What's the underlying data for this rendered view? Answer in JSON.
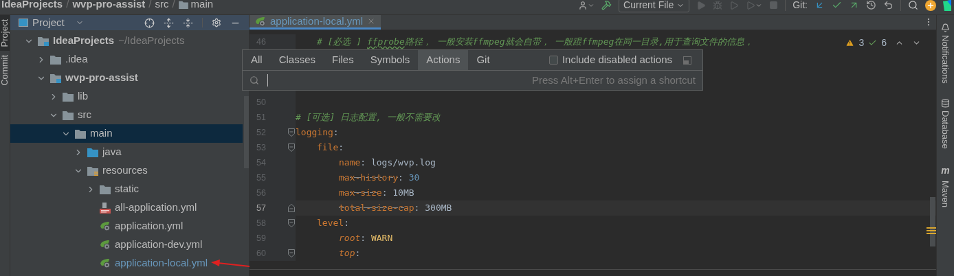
{
  "breadcrumb": [
    {
      "kind": "bold",
      "label": "IdeaProjects"
    },
    {
      "kind": "separator",
      "label": "/"
    },
    {
      "kind": "bold",
      "label": "wvp-pro-assist"
    },
    {
      "kind": "separator",
      "label": "/"
    },
    {
      "kind": "plain",
      "label": "src"
    },
    {
      "kind": "separator",
      "label": "/"
    },
    {
      "kind": "folder",
      "label": "main"
    }
  ],
  "toolbar": {
    "run_config": "Current File",
    "vcs_label": "Git:"
  },
  "side_tabs_left": [
    {
      "label": "Project",
      "selected": true
    },
    {
      "label": "Commit",
      "selected": false
    }
  ],
  "project_panel": {
    "title": "Project",
    "tree": [
      {
        "label": "IdeaProjects",
        "hint": "~/IdeaProjects",
        "kind": "module",
        "expanded": true,
        "selected": false,
        "modified": false,
        "children": [
          {
            "label": ".idea",
            "kind": "folder",
            "expanded": false,
            "selected": false,
            "modified": false
          },
          {
            "label": "wvp-pro-assist",
            "kind": "module",
            "expanded": true,
            "selected": false,
            "modified": false,
            "children": [
              {
                "label": "lib",
                "kind": "folder",
                "expanded": false,
                "selected": false,
                "modified": false
              },
              {
                "label": "src",
                "kind": "folder",
                "expanded": true,
                "selected": false,
                "modified": false,
                "children": [
                  {
                    "label": "main",
                    "kind": "folder",
                    "expanded": true,
                    "selected": true,
                    "modified": false,
                    "children": [
                      {
                        "label": "java",
                        "kind": "source-folder",
                        "expanded": false,
                        "selected": false,
                        "modified": false
                      },
                      {
                        "label": "resources",
                        "kind": "resources-folder",
                        "expanded": true,
                        "selected": false,
                        "modified": false,
                        "children": [
                          {
                            "label": "static",
                            "kind": "folder",
                            "expanded": false,
                            "selected": false,
                            "modified": false
                          },
                          {
                            "label": "all-application.yml",
                            "kind": "yaml-file",
                            "selected": false,
                            "modified": false
                          },
                          {
                            "label": "application.yml",
                            "kind": "spring-file",
                            "selected": false,
                            "modified": false
                          },
                          {
                            "label": "application-dev.yml",
                            "kind": "spring-file",
                            "selected": false,
                            "modified": false
                          },
                          {
                            "label": "application-local.yml",
                            "kind": "spring-file",
                            "selected": false,
                            "modified": true
                          }
                        ]
                      }
                    ]
                  }
                ]
              }
            ]
          }
        ]
      }
    ]
  },
  "editor": {
    "tabs": [
      {
        "label": "application-local.yml",
        "selected": true
      }
    ],
    "inspections": {
      "warnings": "3",
      "weak_warnings": "6"
    },
    "lines": [
      {
        "number": "46",
        "kind": "indent-1",
        "fold_start": false,
        "fold_end": false,
        "current": false,
        "tokens": [
          {
            "kind": "comment",
            "text": "# [必选 ] "
          },
          {
            "kind": "typo",
            "text": "ffprobe"
          },
          {
            "kind": "comment",
            "text": "路径， 一般安装ffmpeg就会自带， 一般跟ffmpeg在同一目录,用于查询文件的信息，"
          }
        ]
      },
      {
        "number": "50",
        "fold_start": false,
        "fold_end": false,
        "current": false
      },
      {
        "number": "51",
        "kind": "indent-0",
        "fold_start": false,
        "fold_end": false,
        "current": false,
        "tokens": [
          {
            "kind": "comment",
            "text": "# [可选] 日志配置, 一般不需要改"
          }
        ]
      },
      {
        "number": "52",
        "kind": "indent-0",
        "fold_start": true,
        "fold_end": false,
        "current": false,
        "tokens": [
          {
            "kind": "key",
            "text": "logging"
          },
          {
            "kind": "punct",
            "text": ":"
          }
        ]
      },
      {
        "number": "53",
        "kind": "indent-1",
        "fold_start": true,
        "fold_end": false,
        "current": false,
        "tokens": [
          {
            "kind": "key",
            "text": "file"
          },
          {
            "kind": "punct",
            "text": ":"
          }
        ]
      },
      {
        "number": "54",
        "kind": "indent-2",
        "fold_start": false,
        "fold_end": false,
        "current": false,
        "tokens": [
          {
            "kind": "key",
            "text": "name"
          },
          {
            "kind": "punct",
            "text": ": "
          },
          {
            "kind": "text",
            "text": "logs/wvp.log"
          }
        ]
      },
      {
        "number": "55",
        "kind": "indent-2",
        "fold_start": false,
        "fold_end": false,
        "current": false,
        "tokens": [
          {
            "kind": "deprecated-key",
            "text": "max-history"
          },
          {
            "kind": "punct",
            "text": ": "
          },
          {
            "kind": "number",
            "text": "30"
          }
        ]
      },
      {
        "number": "56",
        "kind": "indent-2",
        "fold_start": false,
        "fold_end": false,
        "current": false,
        "tokens": [
          {
            "kind": "deprecated-key",
            "text": "max-size"
          },
          {
            "kind": "punct",
            "text": ": "
          },
          {
            "kind": "text",
            "text": "10MB"
          }
        ]
      },
      {
        "number": "57",
        "kind": "indent-2",
        "fold_start": false,
        "fold_end": true,
        "current": true,
        "tokens": [
          {
            "kind": "deprecated-key",
            "text": "total-size-cap"
          },
          {
            "kind": "punct",
            "text": ": "
          },
          {
            "kind": "text",
            "text": "300MB"
          }
        ]
      },
      {
        "number": "58",
        "kind": "indent-1",
        "fold_start": true,
        "fold_end": false,
        "current": false,
        "tokens": [
          {
            "kind": "key",
            "text": "level"
          },
          {
            "kind": "punct",
            "text": ":"
          }
        ]
      },
      {
        "number": "59",
        "kind": "indent-2",
        "fold_start": false,
        "fold_end": false,
        "current": false,
        "tokens": [
          {
            "kind": "italic-key",
            "text": "root"
          },
          {
            "kind": "punct",
            "text": ": "
          },
          {
            "kind": "constant",
            "text": "WARN"
          }
        ]
      },
      {
        "number": "60",
        "kind": "indent-2",
        "fold_start": true,
        "fold_end": false,
        "current": false,
        "tokens": [
          {
            "kind": "italic-key",
            "text": "top"
          },
          {
            "kind": "punct",
            "text": ":"
          }
        ]
      }
    ]
  },
  "popup": {
    "tabs": [
      {
        "label": "All",
        "selected": false
      },
      {
        "label": "Classes",
        "selected": false
      },
      {
        "label": "Files",
        "selected": false
      },
      {
        "label": "Symbols",
        "selected": false
      },
      {
        "label": "Actions",
        "selected": true
      },
      {
        "label": "Git",
        "selected": false
      }
    ],
    "checkbox": {
      "label": "Include disabled actions",
      "checked": false
    },
    "search": {
      "hint": "Press Alt+Enter to assign a shortcut"
    }
  },
  "side_tabs_right": [
    {
      "label": "Notifications",
      "kind": "bell"
    },
    {
      "label": "Database",
      "kind": "database"
    },
    {
      "label": "Maven",
      "kind": "maven",
      "glyph": "m"
    }
  ]
}
